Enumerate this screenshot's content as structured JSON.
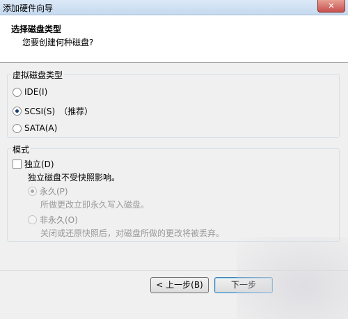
{
  "window": {
    "title": "添加硬件向导",
    "close_glyph": "✕"
  },
  "header": {
    "title": "选择磁盘类型",
    "subtitle": "您要创建何种磁盘?"
  },
  "disk_type_group": {
    "label": "虚拟磁盘类型",
    "options": [
      {
        "label": "IDE(I)",
        "checked": false
      },
      {
        "label": "SCSI(S)",
        "checked": true,
        "hint": "（推荐）"
      },
      {
        "label": "SATA(A)",
        "checked": false
      }
    ]
  },
  "mode_group": {
    "label": "模式",
    "independent_label": "独立(D)",
    "independent_checked": false,
    "independent_note": "独立磁盘不受快照影响。",
    "persistent_label": "永久(P)",
    "persistent_desc": "所做更改立即永久写入磁盘。",
    "nonpersistent_label": "非永久(O)",
    "nonpersistent_desc": "关闭或还原快照后，对磁盘所做的更改将被丢弃。"
  },
  "footer": {
    "back_label": "< 上一步(B)",
    "next_label": "下一步"
  }
}
